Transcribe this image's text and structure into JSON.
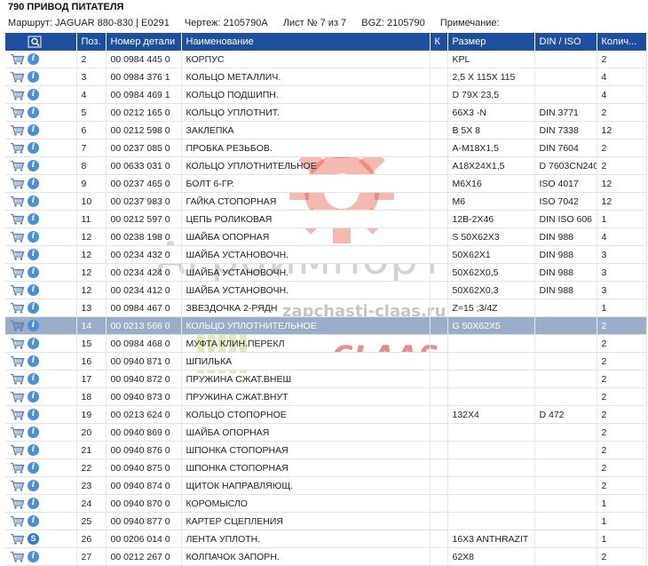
{
  "title": "790 ПРИВОД ПИТАТЕЛЯ",
  "meta": {
    "route": "Маршрут: JAGUAR 880-830 | E0291",
    "drawing": "Чертеж: 2105790A",
    "sheet": "Лист № 7 из 7",
    "bgz": "BGZ: 2105790",
    "note": "Примечание:"
  },
  "columns": {
    "pos": "Поз.",
    "part": "Номер детали",
    "name": "Наименование",
    "k": "К",
    "size": "Размер",
    "din": "DIN / ISO",
    "qty": "Колич..."
  },
  "watermark": {
    "brand": "Агроимпорт",
    "url": "zapchasti-claas.ru",
    "logo": "CLAAS"
  },
  "rows": [
    {
      "pos": "2",
      "part": "00 0984 445 0",
      "name": "КОРПУС",
      "size": "KPL",
      "din": "",
      "qty": "2"
    },
    {
      "pos": "3",
      "part": "00 0984 376 1",
      "name": "КОЛЬЦО МЕТАЛЛИЧ.",
      "size": "2,5 X 115X 115",
      "din": "",
      "qty": "4"
    },
    {
      "pos": "4",
      "part": "00 0984 469 1",
      "name": "КОЛЬЦО ПОДШИПН.",
      "size": "D 79X  23,5",
      "din": "",
      "qty": "4"
    },
    {
      "pos": "5",
      "part": "00 0212 165 0",
      "name": "КОЛЬЦО УПЛОТНИТ.",
      "size": "66X3 -N",
      "din": "DIN 3771",
      "qty": "2"
    },
    {
      "pos": "6",
      "part": "00 0212 598 0",
      "name": "ЗАКЛЕПКА",
      "size": "B 5X 8",
      "din": "DIN 7338",
      "qty": "12"
    },
    {
      "pos": "7",
      "part": "00 0237 085 0",
      "name": "ПРОБКА РЕЗЬБОВ.",
      "size": "A-M18X1,5",
      "din": "DIN 7604",
      "qty": "2"
    },
    {
      "pos": "8",
      "part": "00 0633 031 0",
      "name": "КОЛЬЦО УПЛОТНИТЕЛЬНОЕ",
      "size": "A18X24X1,5",
      "din": "D 7603CN240",
      "qty": "2"
    },
    {
      "pos": "9",
      "part": "00 0237 465 0",
      "name": "БОЛТ 6-ГР.",
      "size": "M6X16",
      "din": "ISO 4017",
      "qty": "12"
    },
    {
      "pos": "10",
      "part": "00 0237 983 0",
      "name": "ГАЙКА СТОПОРНАЯ",
      "size": "M6",
      "din": "ISO 7042",
      "qty": "12"
    },
    {
      "pos": "11",
      "part": "00 0212 597 0",
      "name": "ЦЕПЬ РОЛИКОВАЯ",
      "size": "12B-2X46",
      "din": "DIN ISO 606",
      "qty": "1"
    },
    {
      "pos": "12",
      "part": "00 0238 198 0",
      "name": "ШАЙБА ОПОРНАЯ",
      "size": "S 50X62X3",
      "din": "DIN 988",
      "qty": "4"
    },
    {
      "pos": "12",
      "part": "00 0234 432 0",
      "name": "ШАЙБА УСТАНОВОЧН.",
      "size": "50X62X1",
      "din": "DIN 988",
      "qty": "3"
    },
    {
      "pos": "12",
      "part": "00 0234 424 0",
      "name": "ШАЙБА УСТАНОВОЧН.",
      "size": "50X62X0,5",
      "din": "DIN 988",
      "qty": "3"
    },
    {
      "pos": "12",
      "part": "00 0234 412 0",
      "name": "ШАЙБА УСТАНОВОЧН.",
      "size": "50X62X0,3",
      "din": "DIN 988",
      "qty": "3"
    },
    {
      "pos": "13",
      "part": "00 0984 467 0",
      "name": "ЗВЕЗДОЧКА 2-РЯДН",
      "size": "Z=15 ;3/4Z",
      "din": "",
      "qty": "1"
    },
    {
      "pos": "14",
      "part": "00 0213 566 0",
      "name": "КОЛЬЦО УПЛОТНИТЕЛЬНОЕ",
      "size": "G 50X62X5",
      "din": "",
      "qty": "2"
    },
    {
      "pos": "15",
      "part": "00 0984 468 0",
      "name": "МУФТА КЛИН.ПЕРЕКЛ",
      "size": "",
      "din": "",
      "qty": "2"
    },
    {
      "pos": "16",
      "part": "00 0940 871 0",
      "name": "ШПИЛЬКА",
      "size": "",
      "din": "",
      "qty": "2"
    },
    {
      "pos": "17",
      "part": "00 0940 872 0",
      "name": "ПРУЖИНА СЖАТ.ВНЕШ",
      "size": "",
      "din": "",
      "qty": "2"
    },
    {
      "pos": "18",
      "part": "00 0940 873 0",
      "name": "ПРУЖИНА СЖАТ.ВНУТ",
      "size": "",
      "din": "",
      "qty": "2"
    },
    {
      "pos": "19",
      "part": "00 0213 624 0",
      "name": "КОЛЬЦО СТОПОРНОЕ",
      "size": "132X4",
      "din": "D  472",
      "qty": "2"
    },
    {
      "pos": "20",
      "part": "00 0940 869 0",
      "name": "ШАЙБА ОПОРНАЯ",
      "size": "",
      "din": "",
      "qty": "2"
    },
    {
      "pos": "21",
      "part": "00 0940 876 0",
      "name": "ШПОНКА СТОПОРНАЯ",
      "size": "",
      "din": "",
      "qty": "2"
    },
    {
      "pos": "22",
      "part": "00 0940 875 0",
      "name": "ШПОНКА СТОПОРНАЯ",
      "size": "",
      "din": "",
      "qty": "2"
    },
    {
      "pos": "23",
      "part": "00 0940 874 0",
      "name": "ЩИТОК НАПРАВЛЯЮЩ.",
      "size": "",
      "din": "",
      "qty": "2"
    },
    {
      "pos": "24",
      "part": "00 0940 870 0",
      "name": "КОРОМЫСЛО",
      "size": "",
      "din": "",
      "qty": "1"
    },
    {
      "pos": "25",
      "part": "00 0940 877 0",
      "name": "КАРТЕР СЦЕПЛЕНИЯ",
      "size": "",
      "din": "",
      "qty": "1"
    },
    {
      "pos": "26",
      "part": "00 0206 014 0",
      "name": "ЛЕНТА УПЛОТН.",
      "size": "16X3 ANTHRAZIT",
      "din": "",
      "qty": "1"
    },
    {
      "pos": "27",
      "part": "00 0212 267 0",
      "name": "КОЛПАЧОК ЗАПОРН.",
      "size": "62X8",
      "din": "",
      "qty": "2"
    }
  ]
}
